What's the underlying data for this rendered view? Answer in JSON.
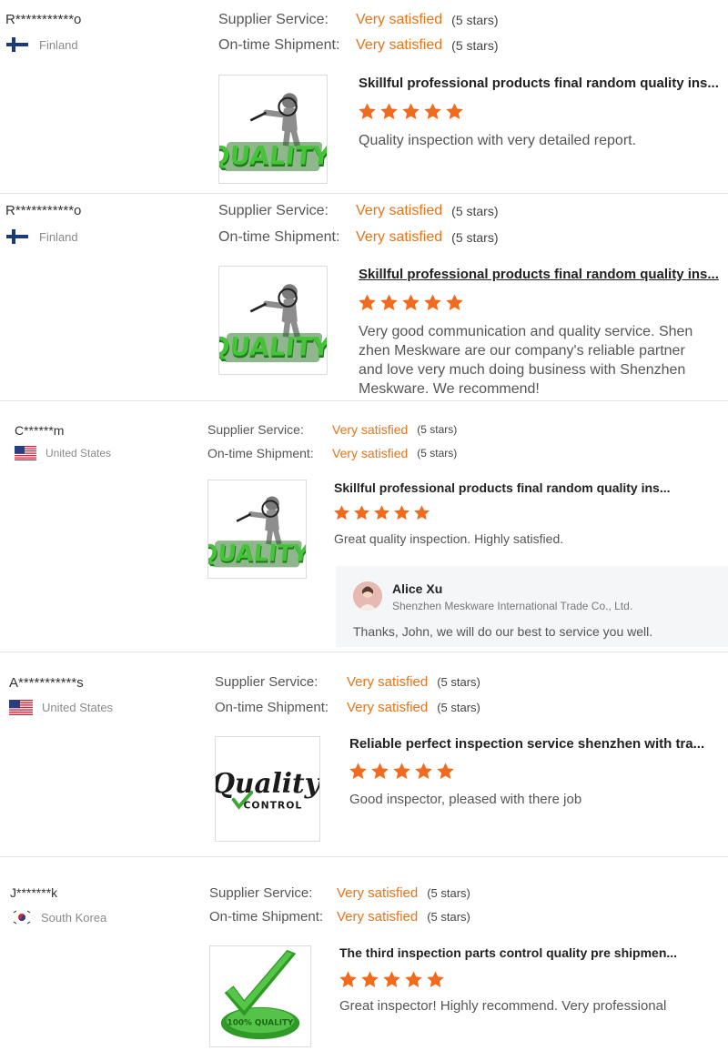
{
  "labels": {
    "supplier_service": "Supplier Service:",
    "on_time_shipment": "On-time Shipment:"
  },
  "colors": {
    "accent": "#e8731a",
    "quality_green": "#3aa832",
    "divider": "#e3e3e3"
  },
  "reviews": [
    {
      "name": "R***********o",
      "country": "Finland",
      "flag": "finland-flag-icon",
      "supplier_value": "Very satisfied",
      "supplier_count": "(5 stars)",
      "shipment_value": "Very satisfied",
      "shipment_count": "(5 stars)",
      "product_title": "Skillful professional products final random quality ins...",
      "product_image": "quality-magnifier-image",
      "stars": 5,
      "comment": "Quality inspection with very detailed report."
    },
    {
      "name": "R***********o",
      "country": "Finland",
      "flag": "finland-flag-icon",
      "supplier_value": "Very satisfied",
      "supplier_count": "(5 stars)",
      "shipment_value": "Very satisfied",
      "shipment_count": "(5 stars)",
      "product_title": "Skillful professional products final random quality ins...",
      "product_image": "quality-magnifier-image",
      "stars": 5,
      "comment": "Very good communication and quality service. Shen zhen Meskware are our company's reliable partner and love very much doing business with Shenzhen Meskware. We recommend!"
    },
    {
      "name": "C******m",
      "country": "United States",
      "flag": "usa-flag-icon",
      "supplier_value": "Very satisfied",
      "supplier_count": "(5 stars)",
      "shipment_value": "Very satisfied",
      "shipment_count": "(5 stars)",
      "product_title": "Skillful professional products final random quality ins...",
      "product_image": "quality-magnifier-image",
      "stars": 5,
      "comment": "Great quality inspection. Highly satisfied.",
      "reply": {
        "author": "Alice Xu",
        "company": "Shenzhen Meskware International Trade Co., Ltd.",
        "text": "Thanks, John, we will do our best to service you well."
      }
    },
    {
      "name": "A***********s",
      "country": "United States",
      "flag": "usa-flag-icon",
      "supplier_value": "Very satisfied",
      "supplier_count": "(5 stars)",
      "shipment_value": "Very satisfied",
      "shipment_count": "(5 stars)",
      "product_title": "Reliable perfect inspection service shenzhen with tra...",
      "product_image": "quality-control-logo-image",
      "product_image_text": {
        "script": "Quality",
        "caption": "CONTROL"
      },
      "stars": 5,
      "comment": "Good inspector, pleased with there job"
    },
    {
      "name": "J*******k",
      "country": "South Korea",
      "flag": "south-korea-flag-icon",
      "supplier_value": "Very satisfied",
      "supplier_count": "(5 stars)",
      "shipment_value": "Very satisfied",
      "shipment_count": "(5 stars)",
      "product_title": "The third inspection parts control quality pre shipmen...",
      "product_image": "green-checkmark-quality-seal-image",
      "product_image_text": {
        "seal": "100% QUALITY"
      },
      "stars": 5,
      "comment": "Great inspector! Highly recommend. Very professional"
    }
  ]
}
